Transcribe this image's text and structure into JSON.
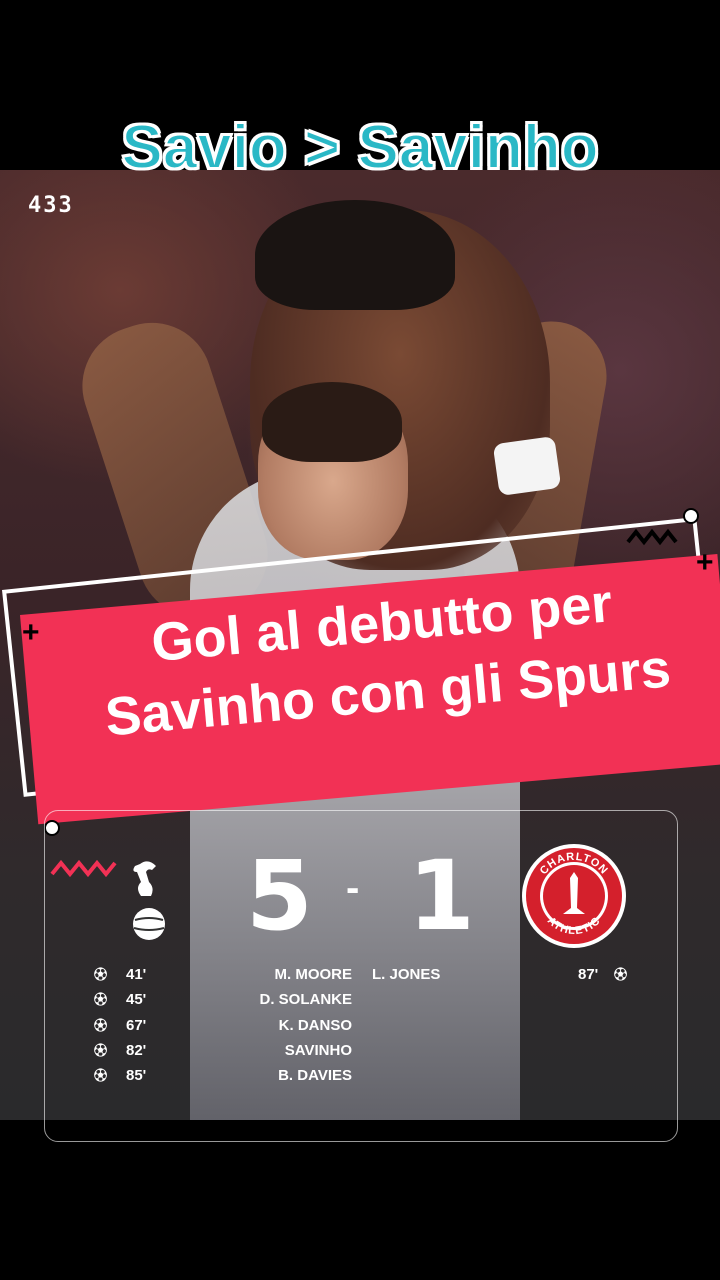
{
  "headline": "Savio > Savinho",
  "brand": "433",
  "banner": {
    "line1": "Gol al debutto per",
    "line2": "Savinho con gli Spurs"
  },
  "match": {
    "home_score": "5",
    "separator": "-",
    "away_score": "1",
    "away_badge_top": "CHARLTON",
    "away_badge_bottom": "ATHLETIC",
    "home_goals": [
      {
        "minute": "41'",
        "scorer": "M. MOORE"
      },
      {
        "minute": "45'",
        "scorer": "D. SOLANKE"
      },
      {
        "minute": "67'",
        "scorer": "K. DANSO"
      },
      {
        "minute": "82'",
        "scorer": "SAVINHO"
      },
      {
        "minute": "85'",
        "scorer": "B. DAVIES"
      }
    ],
    "away_goals": [
      {
        "minute": "87'",
        "scorer": "L. JONES"
      }
    ]
  },
  "colors": {
    "headline": "#2ab8c6",
    "banner": "#f23155"
  },
  "icons": [
    "football-icon",
    "spurs-crest",
    "charlton-crest"
  ]
}
